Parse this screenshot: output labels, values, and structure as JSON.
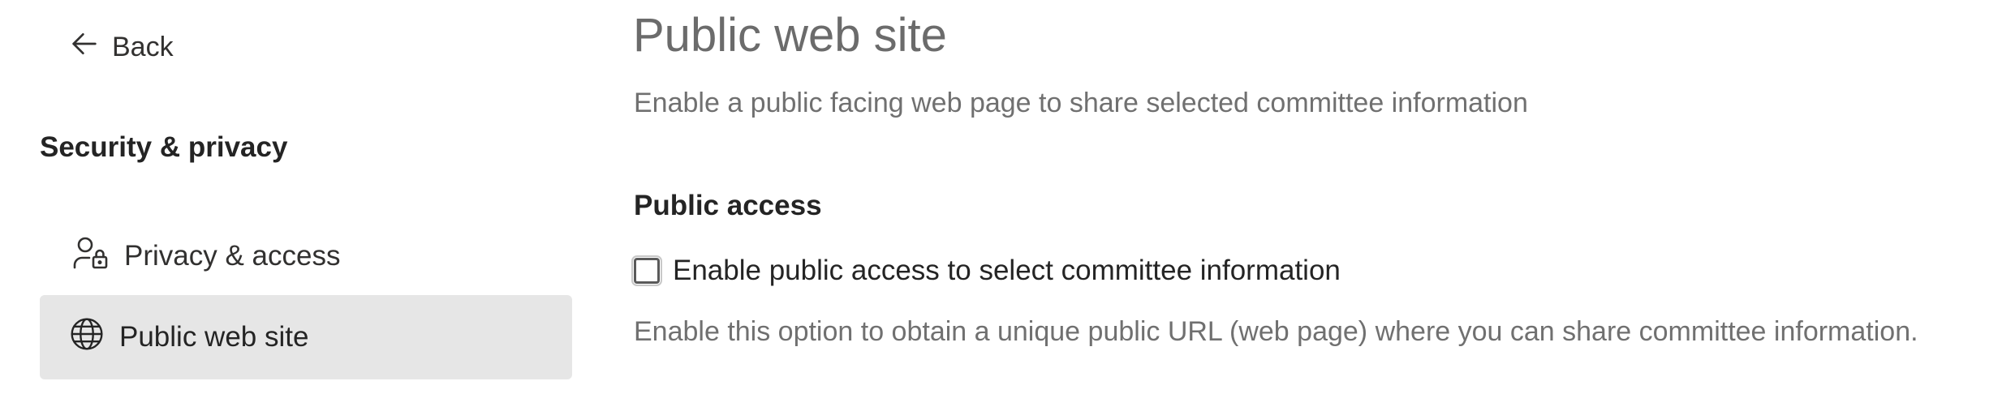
{
  "sidebar": {
    "back_label": "Back",
    "section_title": "Security & privacy",
    "items": [
      {
        "label": "Privacy & access",
        "icon": "person-lock-icon",
        "selected": false
      },
      {
        "label": "Public web site",
        "icon": "globe-icon",
        "selected": true
      }
    ]
  },
  "main": {
    "title": "Public web site",
    "subtitle": "Enable a public facing web page to share selected committee information",
    "section_heading": "Public access",
    "checkbox_label": "Enable public access to select committee information",
    "checkbox_checked": false,
    "help_text": "Enable this option to obtain a unique public URL (web page) where you can share committee information."
  },
  "colors": {
    "selected_bg": "#e6e6e6",
    "muted_text": "#707070",
    "title_text": "#6b6b6b"
  }
}
